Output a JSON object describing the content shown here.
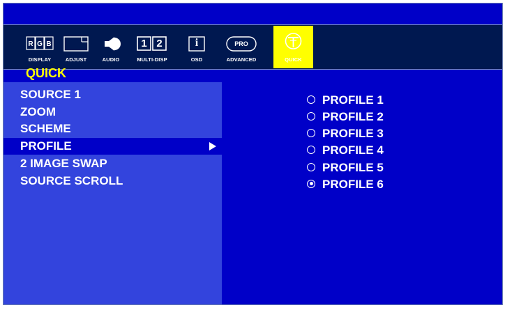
{
  "toolbar": {
    "icons": [
      {
        "name": "display",
        "label": "DISPLAY",
        "glyph": "R G B"
      },
      {
        "name": "adjust",
        "label": "ADJUST",
        "glyph": ""
      },
      {
        "name": "audio",
        "label": "AUDIO",
        "glyph": ""
      },
      {
        "name": "multi-disp",
        "label": "MULTI-DISP",
        "glyph_a": "1",
        "glyph_b": "2"
      },
      {
        "name": "osd",
        "label": "OSD",
        "glyph": "i"
      },
      {
        "name": "advanced",
        "label": "ADVANCED",
        "glyph": "PRO"
      },
      {
        "name": "quick",
        "label": "QUICK",
        "glyph": ""
      }
    ],
    "active": "quick",
    "active_color": "#ffff00"
  },
  "section_title": "QUICK",
  "menu": {
    "items": [
      {
        "label": "SOURCE 1"
      },
      {
        "label": "ZOOM"
      },
      {
        "label": "SCHEME"
      },
      {
        "label": "PROFILE",
        "selected": true
      },
      {
        "label": "2 IMAGE SWAP"
      },
      {
        "label": "SOURCE SCROLL"
      }
    ]
  },
  "options": {
    "items": [
      {
        "label": "PROFILE 1",
        "checked": false
      },
      {
        "label": "PROFILE 2",
        "checked": false
      },
      {
        "label": "PROFILE 3",
        "checked": false
      },
      {
        "label": "PROFILE 4",
        "checked": false
      },
      {
        "label": "PROFILE 5",
        "checked": false
      },
      {
        "label": "PROFILE 6",
        "checked": true
      }
    ]
  },
  "colors": {
    "background": "#0000c8",
    "left_panel": "#3344dd",
    "toolbar": "#001850",
    "title": "#ffff00",
    "text": "#ffffff"
  }
}
